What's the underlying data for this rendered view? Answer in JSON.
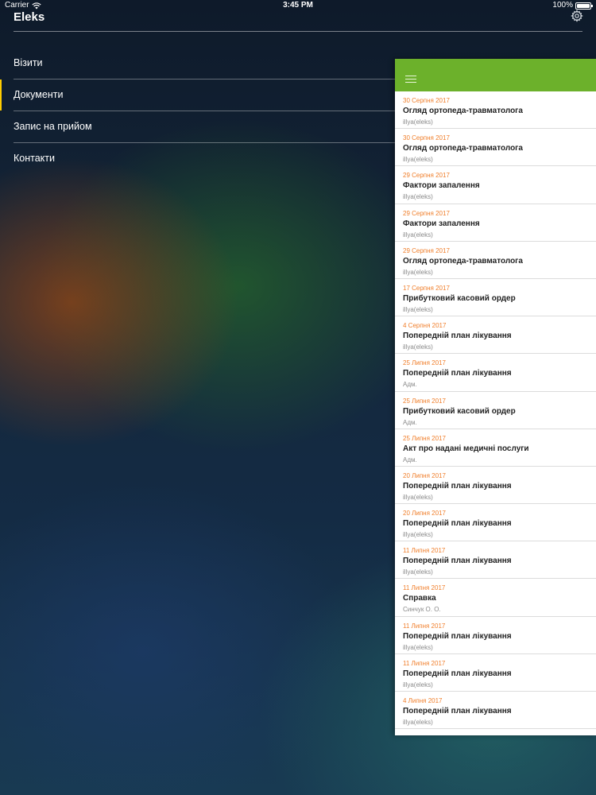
{
  "status_bar": {
    "carrier": "Carrier",
    "time": "3:45 PM",
    "battery": "100%"
  },
  "app": {
    "title": "Eleks"
  },
  "menu": {
    "items": [
      {
        "label": "Візити"
      },
      {
        "label": "Документи"
      },
      {
        "label": "Запис на прийом"
      },
      {
        "label": "Контакти"
      }
    ]
  },
  "documents": {
    "items": [
      {
        "date": "30 Серпня 2017",
        "title": "Огляд ортопеда-травматолога",
        "author": "illya(eleks)"
      },
      {
        "date": "30 Серпня 2017",
        "title": "Огляд ортопеда-травматолога",
        "author": "illya(eleks)"
      },
      {
        "date": "29 Серпня 2017",
        "title": "Фактори запалення",
        "author": "illya(eleks)"
      },
      {
        "date": "29 Серпня 2017",
        "title": "Фактори запалення",
        "author": "illya(eleks)"
      },
      {
        "date": "29 Серпня 2017",
        "title": "Огляд ортопеда-травматолога",
        "author": "illya(eleks)"
      },
      {
        "date": "17 Серпня 2017",
        "title": "Прибутковий касовий ордер",
        "author": "illya(eleks)"
      },
      {
        "date": "4 Серпня 2017",
        "title": "Попередній план лікування",
        "author": "illya(eleks)"
      },
      {
        "date": "25 Липня 2017",
        "title": "Попередній план лікування",
        "author": "Адм."
      },
      {
        "date": "25 Липня 2017",
        "title": "Прибутковий касовий ордер",
        "author": "Адм."
      },
      {
        "date": "25 Липня 2017",
        "title": "Акт про надані медичні послуги",
        "author": "Адм."
      },
      {
        "date": "20 Липня 2017",
        "title": "Попередній план лікування",
        "author": "illya(eleks)"
      },
      {
        "date": "20 Липня 2017",
        "title": "Попередній план лікування",
        "author": "illya(eleks)"
      },
      {
        "date": "11 Липня 2017",
        "title": "Попередній план лікування",
        "author": "illya(eleks)"
      },
      {
        "date": "11 Липня 2017",
        "title": "Справка",
        "author": "Синчук О. О."
      },
      {
        "date": "11 Липня 2017",
        "title": "Попередній план лікування",
        "author": "illya(eleks)"
      },
      {
        "date": "11 Липня 2017",
        "title": "Попередній план лікування",
        "author": "illya(eleks)"
      },
      {
        "date": "4 Липня 2017",
        "title": "Попередній план лікування",
        "author": "illya(eleks)"
      }
    ]
  }
}
